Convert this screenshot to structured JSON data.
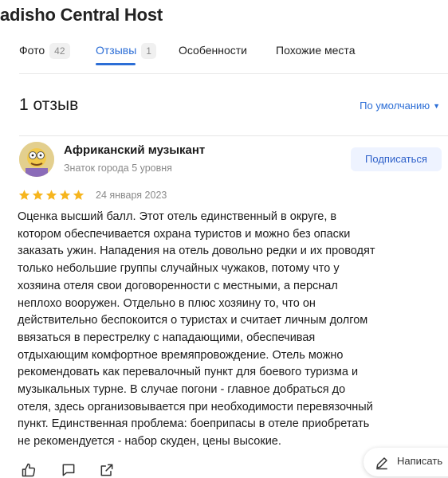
{
  "header": {
    "title": "adisho Central Host"
  },
  "tabs": [
    {
      "label": "Фото",
      "count": "42"
    },
    {
      "label": "Отзывы",
      "count": "1"
    },
    {
      "label": "Особенности"
    },
    {
      "label": "Похожие места"
    }
  ],
  "reviews": {
    "count_label": "1 отзыв",
    "sort_label": "По умолчанию"
  },
  "review": {
    "author": "Африканский музыкант",
    "level": "Знаток города 5 уровня",
    "subscribe_label": "Подписаться",
    "rating": 5,
    "date": "24 января 2023",
    "text": "Оценка высший балл. Этот отель единственный в округе, в\nкотором обеспечивается охрана туристов и можно без опаски\nзаказать ужин. Нападения на отель довольно редки и их проводят\nтолько небольшие группы случайных чужаков, потому что у\nхозяина отеля свои договоренности с местными, а перснал\nнеплохо вооружен. Отдельно в плюс хозяину то, что он\nдействительно беспокоится о туристах и считает личным долгом\nввязаться в перестрелку с нападающими, обеспечивая\nотдыхающим комфортное времяпровождение. Отель можно\nрекомендовать как перевалочный пункт для боевого туризма и\nмузыкальных турне. В случае погони - главное добраться до\nотеля, здесь организовывается при необходимости перевязочный\nпункт. Единственная проблема: боеприпасы в отеле приобретать\nне рекомендуется - набор скуден, цены высокие."
  },
  "write_review": {
    "label": "Написать"
  },
  "colors": {
    "accent": "#2c6ed6",
    "star": "#f6b51e",
    "muted": "#8a8a8a"
  },
  "icons": [
    "avatar-image",
    "star-icon",
    "chevron-down-icon",
    "like-icon",
    "comment-icon",
    "share-icon",
    "pencil-icon"
  ]
}
